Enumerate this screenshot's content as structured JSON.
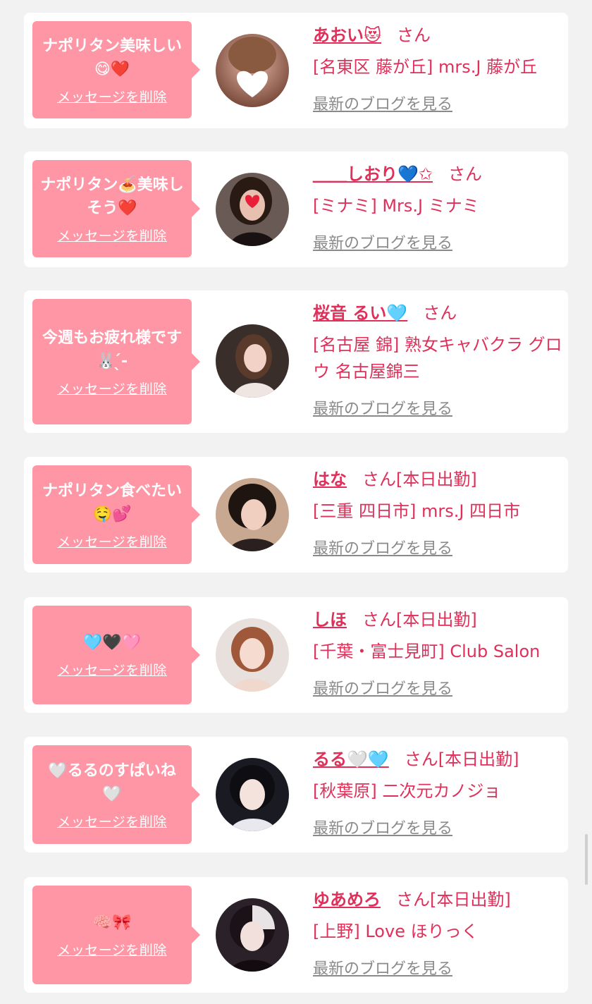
{
  "common": {
    "delete_label": "メッセージを削除",
    "blog_label": "最新のブログを見る",
    "san": "さん"
  },
  "colors": {
    "page_bg": "#f2f2f2",
    "bubble": "#ff96a5",
    "accent": "#e0305a",
    "muted": "#8a8a8a"
  },
  "items": [
    {
      "message": "ナポリタン美味しい😋❤️",
      "name": "あおい😻",
      "status": "",
      "shop": "[名東区 藤が丘] mrs.J 藤が丘"
    },
    {
      "message": "ナポリタン🍝美味しそう❤️",
      "name": "＿＿しおり💙✩",
      "status": "",
      "shop": "[ミナミ] Mrs.J ミナミ"
    },
    {
      "message": "今週もお疲れ様です🐰 ̖́-‬",
      "name": "桜音 るい🩵",
      "status": "",
      "shop": "[名古屋 錦] 熟女キャバクラ グロウ 名古屋錦三"
    },
    {
      "message": "ナポリタン食べたい🤤💕",
      "name": "はな",
      "status": "[本日出勤]",
      "shop": "[三重 四日市] mrs.J 四日市"
    },
    {
      "message": "🩵🖤🩷",
      "name": "しほ",
      "status": "[本日出勤]",
      "shop": "[千葉・富士見町] Club Salon"
    },
    {
      "message": "🤍るるのすぱいね🤍",
      "name": "るる🤍🩵",
      "status": "[本日出勤]",
      "shop": "[秋葉原] 二次元カノジョ"
    },
    {
      "message": "🧠🎀",
      "name": "ゆあめろ",
      "status": "[本日出勤]",
      "shop": "[上野] Love ほりっく"
    }
  ]
}
